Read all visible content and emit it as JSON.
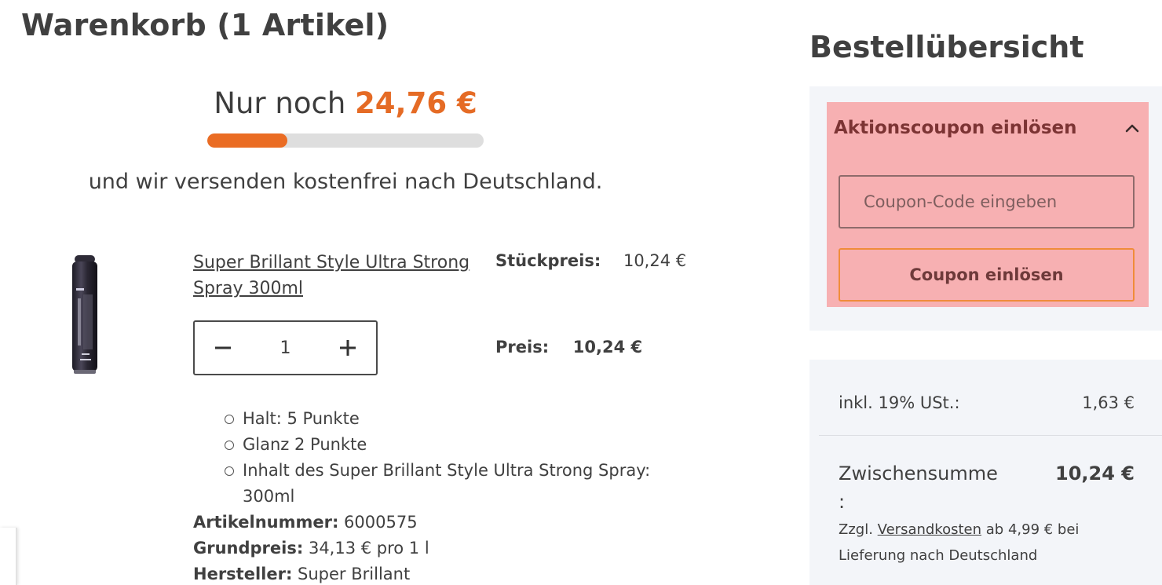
{
  "cart": {
    "title": "Warenkorb (1 Artikel)",
    "shipping": {
      "prefix": "Nur noch",
      "amount": "24,76 €",
      "progress_percent": 29,
      "subtext": "und wir versenden kostenfrei nach Deutschland.",
      "accent_color": "#ea6c23"
    },
    "item": {
      "image_icon": "hairspray-can",
      "name": "Super Brillant Style Ultra Strong Spray 300ml",
      "unit_price_label": "Stückpreis:",
      "unit_price_value": "10,24 €",
      "quantity": "1",
      "decrease_icon": "minus-icon",
      "increase_icon": "plus-icon",
      "price_label": "Preis:",
      "price_value": "10,24 €",
      "features": [
        "Halt: 5 Punkte",
        "Glanz 2 Punkte",
        "Inhalt des Super Brillant Style Ultra Strong Spray: 300ml"
      ],
      "specs": {
        "article_number_label": "Artikelnummer:",
        "article_number_value": "6000575",
        "base_price_label": "Grundpreis:",
        "base_price_value": "34,13 € pro 1 l",
        "manufacturer_label": "Hersteller:",
        "manufacturer_value": "Super Brillant"
      }
    }
  },
  "summary": {
    "title": "Bestellübersicht",
    "coupon": {
      "heading": "Aktionscoupon einlösen",
      "toggle_icon": "chevron-up-icon",
      "input_placeholder": "Coupon-Code eingeben",
      "button_label": "Coupon einlösen",
      "highlight_color": "#f7b0b2"
    },
    "tax_label": "inkl. 19% USt.:",
    "tax_value": "1,63 €",
    "subtotal_label": "Zwischensumme :",
    "subtotal_value": "10,24 €",
    "shipping_note_prefix": "Zzgl.",
    "shipping_note_link": "Versandkosten",
    "shipping_note_suffix": "ab 4,99 € bei Lieferung nach Deutschland"
  }
}
